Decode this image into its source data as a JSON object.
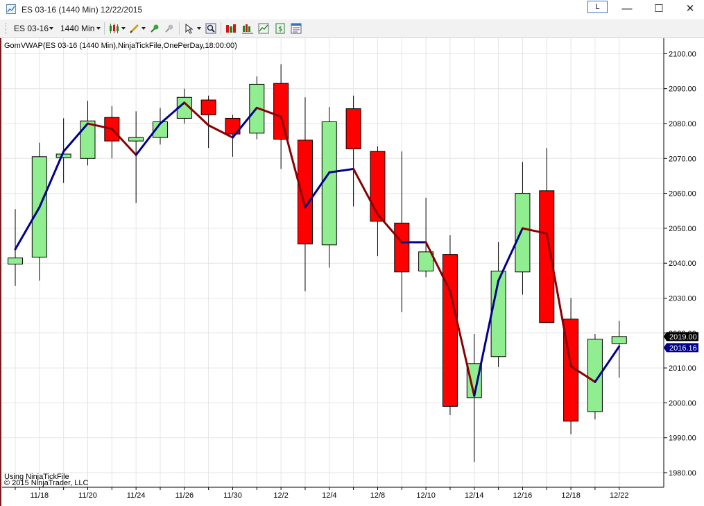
{
  "window": {
    "title": "ES 03-16 (1440 Min)  12/22/2015",
    "layout_button": "L",
    "minimize": "—",
    "maximize": "☐",
    "close": "✕"
  },
  "toolbar": {
    "instrument": "ES 03-16",
    "interval": "1440 Min",
    "icons": [
      "candlestick-icon",
      "pencil-icon",
      "pin-icon",
      "eraser-icon",
      "cursor-icon",
      "zoom-icon",
      "bar-style-icon",
      "chart-style-icon",
      "strategy-icon",
      "properties-icon"
    ]
  },
  "indicator_label": "GomVWAP(ES 03-16 (1440 Min),NinjaTickFile,OnePerDay,18:00:00)",
  "footer": {
    "line1": "Using NinjaTickFile",
    "line2": "© 2015 NinjaTrader, LLC"
  },
  "colors": {
    "up_candle": "#90ee90",
    "down_candle": "#ff0000",
    "vwap_up": "#00008b",
    "vwap_down": "#8b0000",
    "last_price_box": "#000000",
    "vwap_box": "#00008b"
  },
  "chart_data": {
    "type": "candlestick",
    "x_tick_labels": [
      "11/18",
      "11/20",
      "11/24",
      "11/26",
      "11/30",
      "12/2",
      "12/4",
      "12/8",
      "12/10",
      "12/14",
      "12/16",
      "12/18",
      "12/22"
    ],
    "y_ticks": [
      1980,
      1990,
      2000,
      2010,
      2020,
      2030,
      2040,
      2050,
      2060,
      2070,
      2080,
      2090,
      2100
    ],
    "ylim": [
      1976,
      2104
    ],
    "last_price": "2019.00",
    "vwap_last": "2016.16",
    "grid": true,
    "candles": [
      {
        "o": 2039.75,
        "h": 2055.5,
        "l": 2033.5,
        "c": 2041.5
      },
      {
        "o": 2041.75,
        "h": 2074.5,
        "l": 2035.0,
        "c": 2070.5
      },
      {
        "o": 2070.25,
        "h": 2081.5,
        "l": 2063.0,
        "c": 2071.25
      },
      {
        "o": 2070.0,
        "h": 2086.5,
        "l": 2068.0,
        "c": 2080.75
      },
      {
        "o": 2081.75,
        "h": 2085.0,
        "l": 2070.0,
        "c": 2075.0
      },
      {
        "o": 2075.0,
        "h": 2083.5,
        "l": 2057.25,
        "c": 2076.0
      },
      {
        "o": 2076.0,
        "h": 2084.5,
        "l": 2074.0,
        "c": 2080.5
      },
      {
        "o": 2081.5,
        "h": 2090.0,
        "l": 2080.0,
        "c": 2087.5
      },
      {
        "o": 2086.75,
        "h": 2088.0,
        "l": 2073.0,
        "c": 2082.5
      },
      {
        "o": 2081.5,
        "h": 2082.5,
        "l": 2070.5,
        "c": 2077.0
      },
      {
        "o": 2077.25,
        "h": 2093.5,
        "l": 2075.5,
        "c": 2091.25
      },
      {
        "o": 2091.5,
        "h": 2097.0,
        "l": 2067.0,
        "c": 2075.5
      },
      {
        "o": 2075.25,
        "h": 2087.5,
        "l": 2032.0,
        "c": 2045.5
      },
      {
        "o": 2045.25,
        "h": 2084.75,
        "l": 2038.75,
        "c": 2080.5
      },
      {
        "o": 2084.25,
        "h": 2088.0,
        "l": 2056.25,
        "c": 2072.75
      },
      {
        "o": 2072.0,
        "h": 2073.5,
        "l": 2042.0,
        "c": 2052.0
      },
      {
        "o": 2051.5,
        "h": 2072.0,
        "l": 2026.0,
        "c": 2037.5
      },
      {
        "o": 2037.75,
        "h": 2058.75,
        "l": 2036.0,
        "c": 2043.25
      },
      {
        "o": 2042.5,
        "h": 2048.0,
        "l": 1996.5,
        "c": 1999.0
      },
      {
        "o": 2001.5,
        "h": 2019.75,
        "l": 1983.0,
        "c": 2011.25
      },
      {
        "o": 2013.25,
        "h": 2046.0,
        "l": 2010.25,
        "c": 2037.75
      },
      {
        "o": 2037.5,
        "h": 2069.0,
        "l": 2031.0,
        "c": 2060.0
      },
      {
        "o": 2060.75,
        "h": 2073.0,
        "l": 2023.0,
        "c": 2023.0
      },
      {
        "o": 2024.0,
        "h": 2030.0,
        "l": 1991.0,
        "c": 1994.75
      },
      {
        "o": 1997.5,
        "h": 2019.75,
        "l": 1995.25,
        "c": 2018.25
      },
      {
        "o": 2017.0,
        "h": 2023.5,
        "l": 2007.25,
        "c": 2019.0
      }
    ],
    "vwap": [
      2044.0,
      2056.0,
      2072.0,
      2080.0,
      2078.5,
      2071.0,
      2080.0,
      2086.0,
      2079.5,
      2076.0,
      2084.5,
      2082.0,
      2056.0,
      2066.0,
      2067.0,
      2054.0,
      2046.0,
      2046.0,
      2032.0,
      2002.0,
      2035.0,
      2050.0,
      2048.5,
      2010.5,
      2006.0,
      2016.16
    ]
  }
}
